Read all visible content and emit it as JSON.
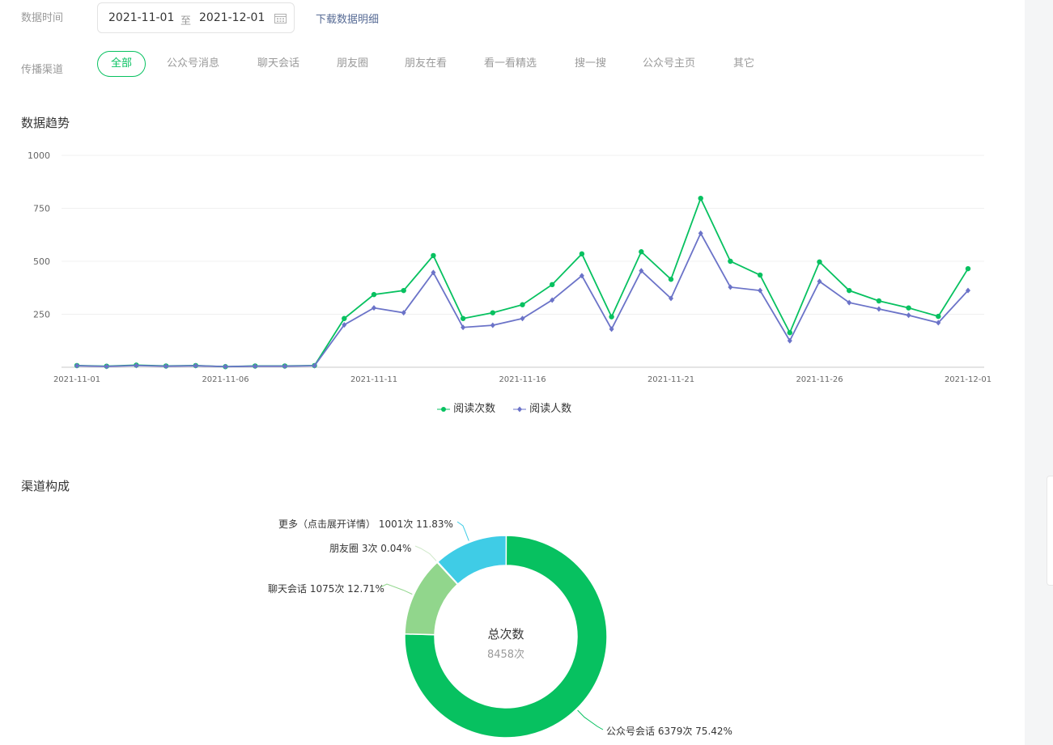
{
  "filters": {
    "date_label": "数据时间",
    "date_start": "2021-11-01",
    "date_sep": "至",
    "date_end": "2021-12-01",
    "download_label": "下载数据明细",
    "channel_label": "传播渠道",
    "channels": [
      "全部",
      "公众号消息",
      "聊天会话",
      "朋友圈",
      "朋友在看",
      "看一看精选",
      "搜一搜",
      "公众号主页",
      "其它"
    ],
    "active_channel": "全部"
  },
  "trend": {
    "title": "数据趋势",
    "chart_data": {
      "type": "line",
      "x": [
        "2021-11-01",
        "2021-11-02",
        "2021-11-03",
        "2021-11-04",
        "2021-11-05",
        "2021-11-06",
        "2021-11-07",
        "2021-11-08",
        "2021-11-09",
        "2021-11-10",
        "2021-11-11",
        "2021-11-12",
        "2021-11-13",
        "2021-11-14",
        "2021-11-15",
        "2021-11-16",
        "2021-11-17",
        "2021-11-18",
        "2021-11-19",
        "2021-11-20",
        "2021-11-21",
        "2021-11-22",
        "2021-11-23",
        "2021-11-24",
        "2021-11-25",
        "2021-11-26",
        "2021-11-27",
        "2021-11-28",
        "2021-11-29",
        "2021-11-30",
        "2021-12-01"
      ],
      "x_tick_labels": [
        "2021-11-01",
        "2021-11-06",
        "2021-11-11",
        "2021-11-16",
        "2021-11-21",
        "2021-11-26",
        "2021-12-01"
      ],
      "y_ticks": [
        "1000",
        "750",
        "500",
        "250"
      ],
      "ylim": [
        0,
        1000
      ],
      "grid": true,
      "legend_position": "bottom-center",
      "series": [
        {
          "name": "阅读次数",
          "color": "#07c160",
          "marker": "circle",
          "values": [
            8,
            5,
            10,
            6,
            8,
            3,
            6,
            6,
            8,
            230,
            343,
            362,
            527,
            230,
            257,
            295,
            390,
            535,
            238,
            545,
            415,
            797,
            500,
            435,
            163,
            497,
            362,
            313,
            280,
            240,
            465
          ]
        },
        {
          "name": "阅读人数",
          "color": "#6b73c8",
          "marker": "diamond",
          "values": [
            7,
            4,
            8,
            5,
            7,
            3,
            5,
            5,
            7,
            200,
            280,
            257,
            447,
            188,
            198,
            230,
            317,
            432,
            180,
            455,
            325,
            632,
            378,
            362,
            125,
            405,
            305,
            275,
            245,
            210,
            362
          ]
        }
      ]
    }
  },
  "composition": {
    "title": "渠道构成",
    "center_title": "总次数",
    "center_value": "8458次",
    "chart_data": {
      "type": "pie",
      "slices": [
        {
          "label": "公众号会话 6379次 75.42%",
          "value": 75.42,
          "color": "#07c160"
        },
        {
          "label": "聊天会话 1075次 12.71%",
          "value": 12.71,
          "color": "#91d68c"
        },
        {
          "label": "朋友圈 3次 0.04%",
          "value": 0.04,
          "color": "#cfe8c9"
        },
        {
          "label": "更多（点击展开详情） 1001次 11.83%",
          "value": 11.83,
          "color": "#3fcce6"
        }
      ]
    }
  }
}
